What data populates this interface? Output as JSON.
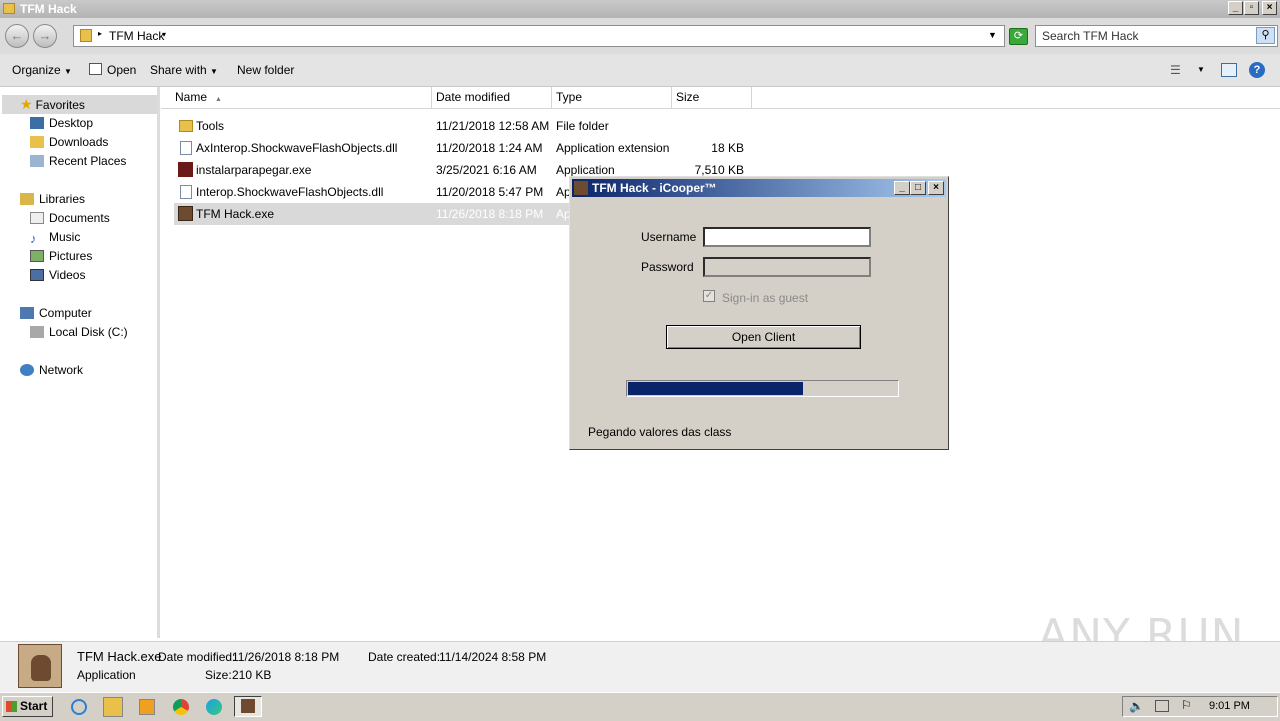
{
  "window": {
    "title": "TFM Hack"
  },
  "nav_buttons": {
    "back": "←",
    "forward": "→"
  },
  "address": {
    "path": "TFM Hack",
    "search_placeholder": "Search TFM Hack"
  },
  "toolbar": {
    "organize": "Organize",
    "open": "Open",
    "share_with": "Share with",
    "new_folder": "New folder"
  },
  "nav_pane": {
    "favorites": "Favorites",
    "desktop": "Desktop",
    "downloads": "Downloads",
    "recent_places": "Recent Places",
    "libraries": "Libraries",
    "documents": "Documents",
    "music": "Music",
    "pictures": "Pictures",
    "videos": "Videos",
    "computer": "Computer",
    "local_disk": "Local Disk (C:)",
    "network": "Network"
  },
  "columns": {
    "name": "Name",
    "date_modified": "Date modified",
    "type": "Type",
    "size": "Size"
  },
  "files": [
    {
      "name": "Tools",
      "date": "11/21/2018 12:58 AM",
      "type": "File folder",
      "size": ""
    },
    {
      "name": "AxInterop.ShockwaveFlashObjects.dll",
      "date": "11/20/2018 1:24 AM",
      "type": "Application extension",
      "size": "18 KB"
    },
    {
      "name": "instalarparapegar.exe",
      "date": "3/25/2021 6:16 AM",
      "type": "Application",
      "size": "7,510 KB"
    },
    {
      "name": "Interop.ShockwaveFlashObjects.dll",
      "date": "11/20/2018 5:47 PM",
      "type": "Ap",
      "size": ""
    },
    {
      "name": "TFM Hack.exe",
      "date": "11/26/2018 8:18 PM",
      "type": "Ap",
      "size": ""
    }
  ],
  "details": {
    "filename": "TFM Hack.exe",
    "date_modified_label": "Date modified:",
    "date_modified": "11/26/2018 8:18 PM",
    "date_created_label": "Date created:",
    "date_created": "11/14/2024 8:58 PM",
    "type": "Application",
    "size_label": "Size:",
    "size": "210 KB"
  },
  "dialog": {
    "title": "TFM Hack - iCooper™",
    "username_label": "Username",
    "password_label": "Password",
    "guest_label": "Sign-in as guest",
    "guest_checked": true,
    "open_client": "Open Client",
    "progress": 0.65,
    "status": "Pegando valores das class"
  },
  "taskbar": {
    "start": "Start",
    "clock": "9:01 PM"
  },
  "watermark": "ANY RUN"
}
